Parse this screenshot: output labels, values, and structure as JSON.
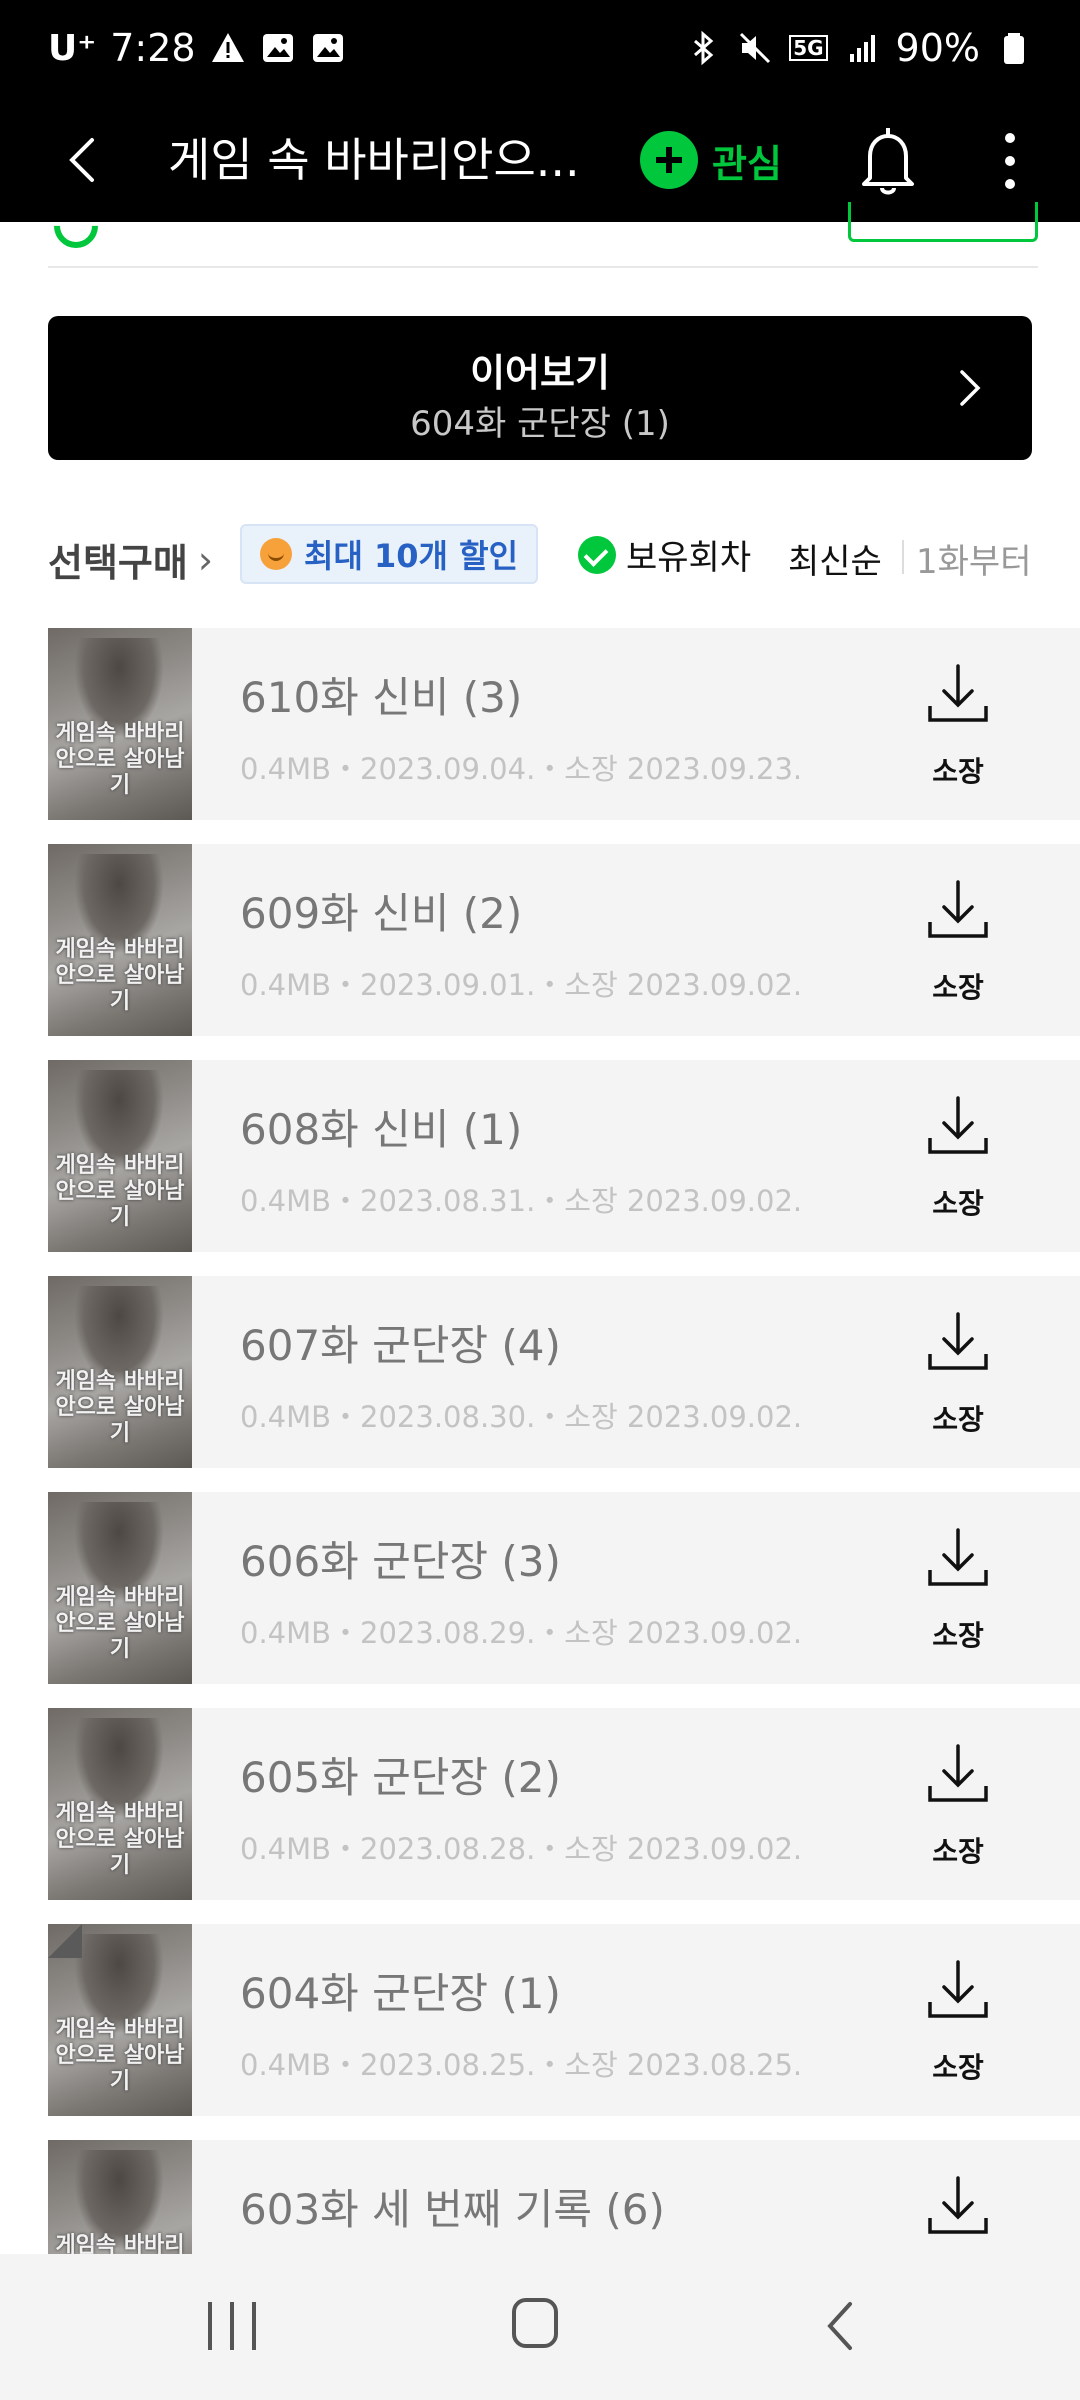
{
  "status_bar": {
    "carrier": "U⁺",
    "time": "7:28",
    "network": "5G",
    "battery": "90%"
  },
  "app_bar": {
    "title": "게임 속 바바리안으...",
    "interest_label": "관심"
  },
  "continue": {
    "title": "이어보기",
    "subtitle": "604화 군단장 (1)"
  },
  "filters": {
    "select_buy": "선택구매",
    "discount": "최대 10개 할인",
    "owned": "보유회차",
    "sort_latest": "최신순",
    "sort_first": "1화부터"
  },
  "thumbnail_text": "게임속 바바리안으로 살아남기",
  "episodes": [
    {
      "title": "610화 신비 (3)",
      "meta": "0.4MB・2023.09.04.・소장 2023.09.23.",
      "action": "소장"
    },
    {
      "title": "609화 신비 (2)",
      "meta": "0.4MB・2023.09.01.・소장 2023.09.02.",
      "action": "소장"
    },
    {
      "title": "608화 신비 (1)",
      "meta": "0.4MB・2023.08.31.・소장 2023.09.02.",
      "action": "소장"
    },
    {
      "title": "607화 군단장 (4)",
      "meta": "0.4MB・2023.08.30.・소장 2023.09.02.",
      "action": "소장"
    },
    {
      "title": "606화 군단장 (3)",
      "meta": "0.4MB・2023.08.29.・소장 2023.09.02.",
      "action": "소장"
    },
    {
      "title": "605화 군단장 (2)",
      "meta": "0.4MB・2023.08.28.・소장 2023.09.02.",
      "action": "소장"
    },
    {
      "title": "604화 군단장 (1)",
      "meta": "0.4MB・2023.08.25.・소장 2023.08.25.",
      "action": "소장",
      "last_read": true
    },
    {
      "title": "603화 세 번째 기록 (6)",
      "meta": "",
      "action": ""
    }
  ],
  "colors": {
    "accent_green": "#00c73c",
    "discount_blue": "#2861c4"
  }
}
